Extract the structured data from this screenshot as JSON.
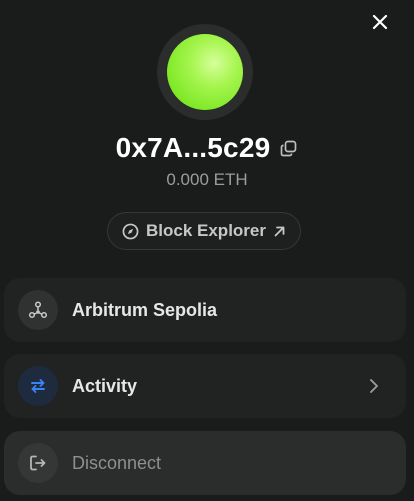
{
  "account": {
    "address": "0x7A...5c29",
    "balance": "0.000 ETH"
  },
  "explorer": {
    "label": "Block Explorer"
  },
  "menu": {
    "network_label": "Arbitrum Sepolia",
    "activity_label": "Activity",
    "disconnect_label": "Disconnect"
  },
  "icons": {
    "close": "close-icon",
    "copy": "copy-icon",
    "compass": "compass-icon",
    "external": "arrow-up-right-icon",
    "network": "network-icon",
    "activity": "swap-arrows-icon",
    "chevron": "chevron-right-icon",
    "disconnect": "logout-icon"
  },
  "colors": {
    "background": "#1a1b1b",
    "avatar": "#8ef03a",
    "activity_accent": "#3b82f6"
  }
}
